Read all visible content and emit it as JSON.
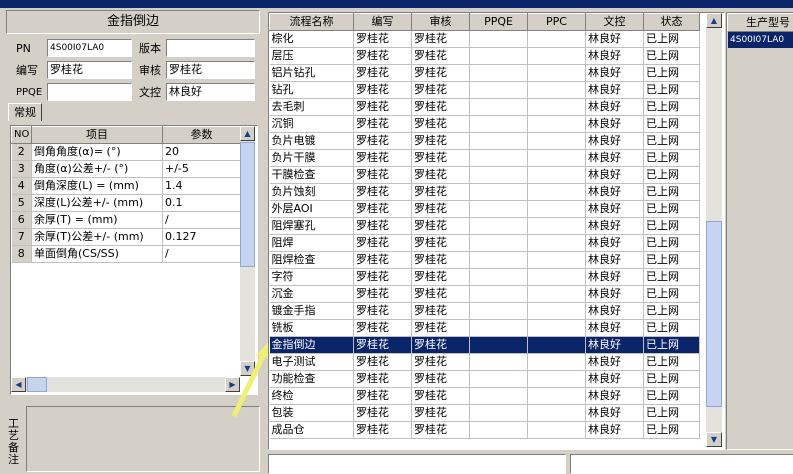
{
  "left_panel": {
    "title": "金指倒边",
    "fields": {
      "pn_label": "PN",
      "pn_value": "4S00I07LA0",
      "version_label": "版本",
      "version_value": "",
      "author_label": "编写",
      "author_value": "罗桂花",
      "review_label": "审核",
      "review_value": "罗桂花",
      "ppqe_label": "PPQE",
      "ppqe_value": "",
      "doc_label": "文控",
      "doc_value": "林良好"
    },
    "tab_label": "常规",
    "param_table": {
      "headers": [
        "NO",
        "项目",
        "参数"
      ],
      "rows": [
        [
          "2",
          "倒角角度(α)=  (°)",
          "20"
        ],
        [
          "3",
          "角度(α)公差+/-  (°)",
          "+/-5"
        ],
        [
          "4",
          "倒角深度(L) =  (mm)",
          "1.4"
        ],
        [
          "5",
          "深度(L)公差+/-  (mm)",
          "0.1"
        ],
        [
          "6",
          "余厚(T) =  (mm)",
          "/"
        ],
        [
          "7",
          "余厚(T)公差+/-  (mm)",
          "0.127"
        ],
        [
          "8",
          "单面倒角(CS/SS)",
          "/"
        ]
      ]
    },
    "remark_label": "工艺备注"
  },
  "process_table": {
    "headers": [
      "流程名称",
      "编写",
      "审核",
      "PPQE",
      "PPC",
      "文控",
      "状态"
    ],
    "rows": [
      [
        "棕化",
        "罗桂花",
        "罗桂花",
        "",
        "",
        "林良好",
        "已上网"
      ],
      [
        "层压",
        "罗桂花",
        "罗桂花",
        "",
        "",
        "林良好",
        "已上网"
      ],
      [
        "铝片钻孔",
        "罗桂花",
        "罗桂花",
        "",
        "",
        "林良好",
        "已上网"
      ],
      [
        "钻孔",
        "罗桂花",
        "罗桂花",
        "",
        "",
        "林良好",
        "已上网"
      ],
      [
        "去毛刺",
        "罗桂花",
        "罗桂花",
        "",
        "",
        "林良好",
        "已上网"
      ],
      [
        "沉铜",
        "罗桂花",
        "罗桂花",
        "",
        "",
        "林良好",
        "已上网"
      ],
      [
        "负片电镀",
        "罗桂花",
        "罗桂花",
        "",
        "",
        "林良好",
        "已上网"
      ],
      [
        "负片干膜",
        "罗桂花",
        "罗桂花",
        "",
        "",
        "林良好",
        "已上网"
      ],
      [
        "干膜检查",
        "罗桂花",
        "罗桂花",
        "",
        "",
        "林良好",
        "已上网"
      ],
      [
        "负片蚀刻",
        "罗桂花",
        "罗桂花",
        "",
        "",
        "林良好",
        "已上网"
      ],
      [
        "外层AOI",
        "罗桂花",
        "罗桂花",
        "",
        "",
        "林良好",
        "已上网"
      ],
      [
        "阻焊塞孔",
        "罗桂花",
        "罗桂花",
        "",
        "",
        "林良好",
        "已上网"
      ],
      [
        "阻焊",
        "罗桂花",
        "罗桂花",
        "",
        "",
        "林良好",
        "已上网"
      ],
      [
        "阻焊检查",
        "罗桂花",
        "罗桂花",
        "",
        "",
        "林良好",
        "已上网"
      ],
      [
        "字符",
        "罗桂花",
        "罗桂花",
        "",
        "",
        "林良好",
        "已上网"
      ],
      [
        "沉金",
        "罗桂花",
        "罗桂花",
        "",
        "",
        "林良好",
        "已上网"
      ],
      [
        "镀金手指",
        "罗桂花",
        "罗桂花",
        "",
        "",
        "林良好",
        "已上网"
      ],
      [
        "铣板",
        "罗桂花",
        "罗桂花",
        "",
        "",
        "林良好",
        "已上网"
      ],
      [
        "金指倒边",
        "罗桂花",
        "罗桂花",
        "",
        "",
        "林良好",
        "已上网"
      ],
      [
        "电子测试",
        "罗桂花",
        "罗桂花",
        "",
        "",
        "林良好",
        "已上网"
      ],
      [
        "功能检查",
        "罗桂花",
        "罗桂花",
        "",
        "",
        "林良好",
        "已上网"
      ],
      [
        "终检",
        "罗桂花",
        "罗桂花",
        "",
        "",
        "林良好",
        "已上网"
      ],
      [
        "包装",
        "罗桂花",
        "罗桂花",
        "",
        "",
        "林良好",
        "已上网"
      ],
      [
        "成品仓",
        "罗桂花",
        "罗桂花",
        "",
        "",
        "林良好",
        "已上网"
      ]
    ],
    "selected_index": 18
  },
  "model_list": {
    "header": "生产型号",
    "items": [
      "4S00I07LA0"
    ]
  },
  "colors": {
    "selection": "#0a246a",
    "face": "#d4d0c8"
  }
}
